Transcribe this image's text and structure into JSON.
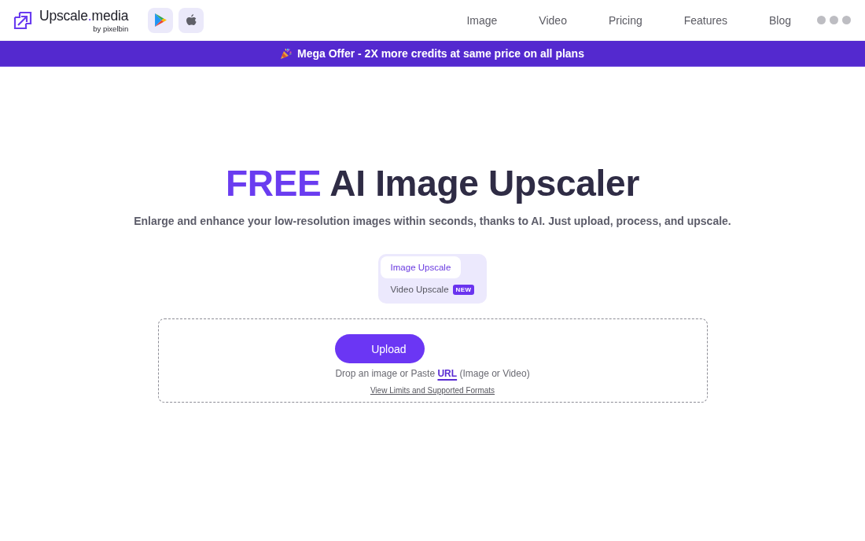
{
  "header": {
    "logo": {
      "name_parts": [
        {
          "text": "Upscale",
          "accent": false
        },
        {
          "text": ".",
          "accent": true
        },
        {
          "text": "media",
          "accent": false
        }
      ],
      "byline": "by pixelbin"
    },
    "store_buttons": [
      {
        "kind": "play"
      },
      {
        "kind": "apple"
      }
    ],
    "nav": [
      "Image",
      "Video",
      "Pricing",
      "Features",
      "Blog"
    ]
  },
  "banner": {
    "text": "Mega Offer - 2X more credits at same price on all plans"
  },
  "hero": {
    "title_accent": "FREE",
    "title_rest": "AI Image Upscaler",
    "subtitle": "Enlarge and enhance your low-resolution images within seconds, thanks to AI. Just upload, process, and upscale."
  },
  "mode_tabs": [
    {
      "label": "Image Upscale",
      "selected": true
    },
    {
      "label": "Video Upscale",
      "selected": false,
      "badge": "NEW"
    }
  ],
  "upload": {
    "button": "Upload",
    "hint_before": "Drop an image or Paste",
    "hint_link": "URL",
    "hint_after": "(Image or Video)",
    "limits_link": "View Limits and Supported Formats"
  }
}
